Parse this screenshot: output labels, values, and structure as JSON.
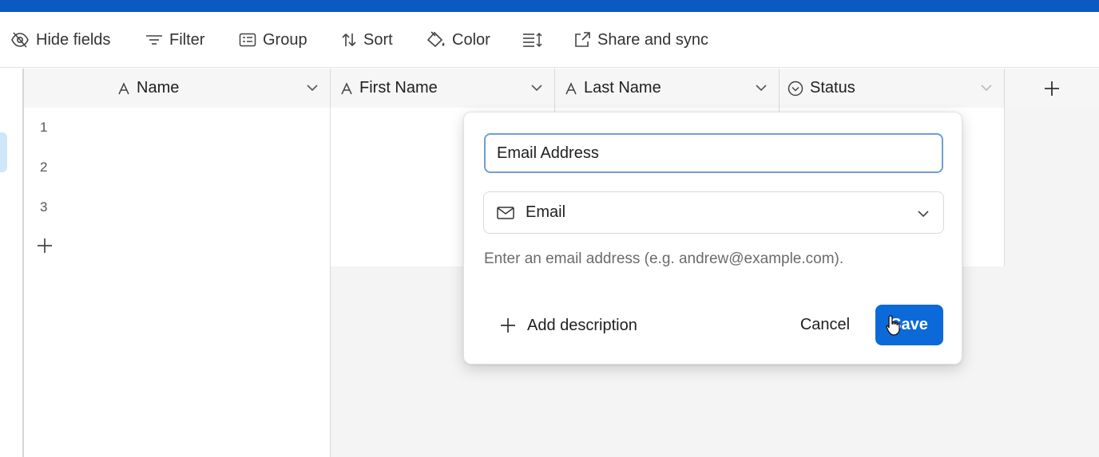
{
  "toolbar": {
    "hide_fields": "Hide fields",
    "filter": "Filter",
    "group": "Group",
    "sort": "Sort",
    "color": "Color",
    "share_and_sync": "Share and sync"
  },
  "grid": {
    "columns": [
      {
        "label": "Name",
        "icon": "text-field-icon"
      },
      {
        "label": "First Name",
        "icon": "text-field-icon"
      },
      {
        "label": "Last Name",
        "icon": "text-field-icon"
      },
      {
        "label": "Status",
        "icon": "single-select-icon"
      }
    ],
    "rows": [
      {
        "number": "1"
      },
      {
        "number": "2"
      },
      {
        "number": "3"
      }
    ]
  },
  "popup": {
    "field_name_value": "Email Address",
    "field_type": "Email",
    "hint": "Enter an email address (e.g. andrew@example.com).",
    "add_description": "Add description",
    "cancel": "Cancel",
    "save": "Save"
  },
  "colors": {
    "topbar": "#0a5ac2",
    "save_button": "#0c6ad8",
    "input_focus_border": "#6f9ed6"
  }
}
